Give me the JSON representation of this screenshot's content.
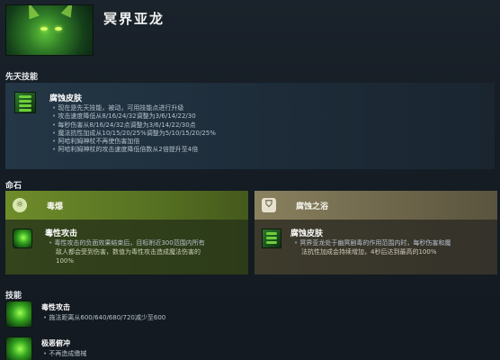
{
  "hero": {
    "name": "冥界亚龙"
  },
  "innate": {
    "section_title": "先天技能",
    "ability_name": "腐蚀皮肤",
    "lines": [
      "现在是先天技能，被动，可用技能点进行升级",
      "攻击速度降低从8/16/24/32调整为3/6/14/22/30",
      "每秒伤害从8/16/24/32点调整为3/6/14/22/30点",
      "魔法抗性加成从10/15/20/25%调整为5/10/15/20/25%",
      "阿哈利姆神杖不再使伤害加倍",
      "阿哈利姆神杖的攻击速度降低倍数从2倍提升至4倍"
    ]
  },
  "facets": {
    "section_title": "命石",
    "left": {
      "symbol": "☼",
      "title": "毒爆",
      "ability_name": "毒性攻击",
      "desc_lines": [
        "毒性攻击的负面效果结束后，目标附近300范围内所有",
        "敌人都会受到伤害，数值为毒性攻击造成魔法伤害的",
        "100%"
      ]
    },
    "right": {
      "symbol": "⛉",
      "title": "腐蚀之浴",
      "ability_name": "腐蚀皮肤",
      "desc_lines": [
        "冥界亚龙处于幽冥剧毒的作用范围内时，每秒伤害和魔",
        "法抗性加成会持续增加，4秒后达到最高的100%"
      ]
    }
  },
  "skills": {
    "section_title": "技能",
    "items": [
      {
        "name": "毒性攻击",
        "lines": [
          "施法距离从600/640/680/720减少至600"
        ]
      },
      {
        "name": "极恶俯冲",
        "lines": [
          "不再造成缴械"
        ]
      }
    ]
  }
}
